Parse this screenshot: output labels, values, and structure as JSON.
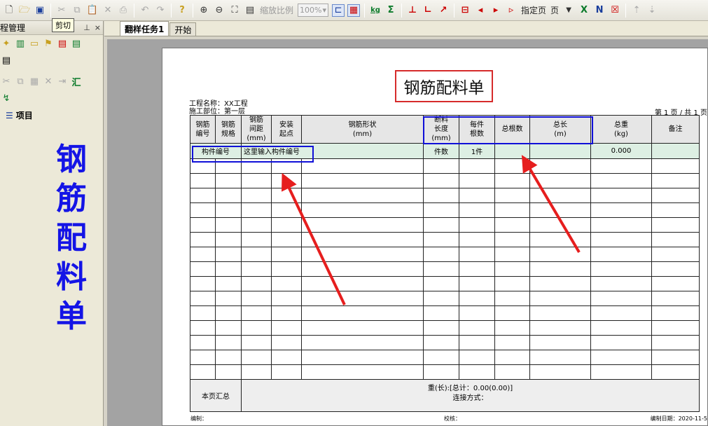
{
  "toolbar": {
    "zoom_label": "缩放比例",
    "zoom_value": "100%",
    "page_select_label": "指定页",
    "page_label": "页",
    "kg_label": "kg",
    "icons": [
      "new-icon",
      "open-icon",
      "save-icon",
      "cut-icon",
      "copy-icon",
      "paste-icon",
      "delete-icon",
      "print-icon",
      "undo-icon",
      "redo-icon",
      "help-icon",
      "zoom-in-icon",
      "zoom-out-icon",
      "fit-icon",
      "page-icon",
      "tree-icon",
      "grid-icon",
      "weight-icon",
      "summary-icon",
      "chart-icon",
      "chart2-icon",
      "export-icon",
      "first-page-icon",
      "prev-page-icon",
      "next-page-icon",
      "last-page-icon",
      "excel-icon",
      "word-icon",
      "close-icon",
      "up-icon",
      "down-icon"
    ]
  },
  "left_panel": {
    "title": "程管理",
    "tooltip": "剪切",
    "pin": "ᛣ",
    "close": "×",
    "tree_item": "项目",
    "big_title_chars": [
      "钢",
      "筋",
      "配",
      "料",
      "单"
    ]
  },
  "tabs": [
    {
      "label": "翻样任务1",
      "active": true
    },
    {
      "label": "开始",
      "active": false
    }
  ],
  "document": {
    "title": "钢筋配料单",
    "project_name": "工程名称：XX工程",
    "construction_part": "施工部位：第一层",
    "page_info": "第 1 页 / 共 1 页",
    "headers": {
      "rebar_no": [
        "钢筋",
        "编号"
      ],
      "rebar_spec": [
        "钢筋",
        "规格"
      ],
      "rebar_spacing": [
        "钢筋",
        "间距",
        "(mm)"
      ],
      "install_start": [
        "安装",
        "起点"
      ],
      "rebar_shape": [
        "钢筋形状",
        "(mm)"
      ],
      "cut_length": [
        "断料",
        "长度",
        "(mm)"
      ],
      "per_piece": [
        "每件",
        "根数"
      ],
      "total_count": "总根数",
      "total_length": [
        "总长",
        "(m)"
      ],
      "total_weight": [
        "总重",
        "(kg)"
      ],
      "remark": "备注"
    },
    "first_row": {
      "component_no": "构件编号",
      "input_hint": "这里输入构件编号",
      "piece_count": "件数",
      "pieces": "1件",
      "weight": "0.000"
    },
    "empty_rows": 15,
    "footer": {
      "page_summary": "本页汇总",
      "weight_line": "重(长):[总计：0.00(0.00)]",
      "connection": "连接方式：",
      "prepared_by": "编制：",
      "checked_by": "校核：",
      "date": "编制日期：2020-11-5"
    }
  }
}
